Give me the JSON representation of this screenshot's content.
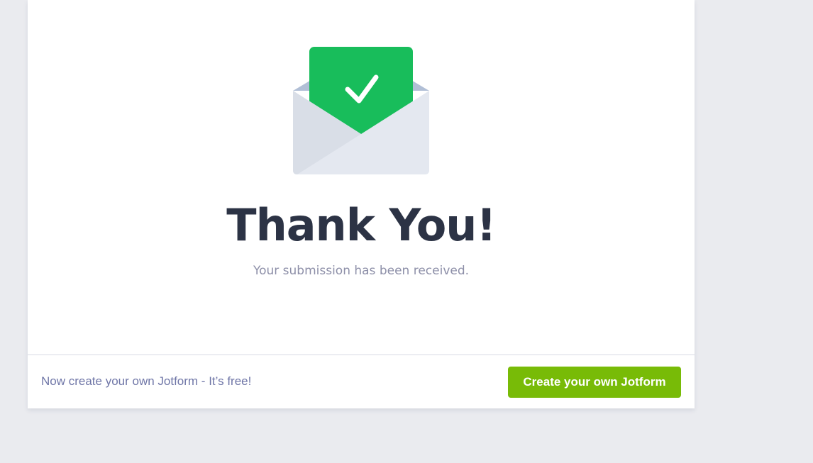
{
  "main": {
    "icon": "envelope-check-icon",
    "title": "Thank You!",
    "subtitle": "Your submission has been received."
  },
  "footer": {
    "text": "Now create your own Jotform - It’s free!",
    "button_label": "Create your own Jotform"
  },
  "colors": {
    "page_background": "#eaebef",
    "card_background": "#ffffff",
    "success_green": "#18bd5b",
    "cta_green": "#78bb07",
    "title": "#2c3345",
    "subtitle": "#8d8fa8",
    "footer_text": "#6f76a7"
  }
}
